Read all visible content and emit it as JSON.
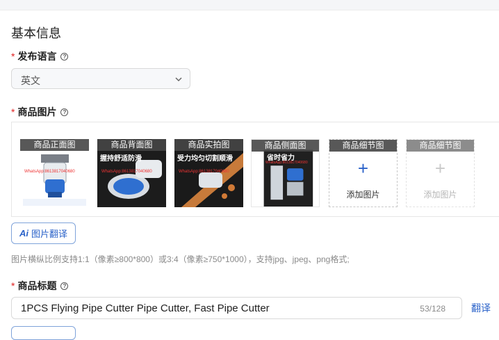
{
  "section": {
    "title": "基本信息"
  },
  "language": {
    "label": "发布语言",
    "required_mark": "*",
    "value": "英文"
  },
  "images": {
    "label": "商品图片",
    "required_mark": "*",
    "thumbnails": [
      {
        "label": "商品正面图",
        "watermark": "WhatsApp:8613817040680"
      },
      {
        "label": "商品背面图",
        "overlay": "握持舒适防滑",
        "watermark": "WhatsApp:8613817040680"
      },
      {
        "label": "商品实拍图",
        "overlay": "受力均匀切割顺滑",
        "watermark": "WhatsApp:8613817040680"
      },
      {
        "label": "商品侧面图",
        "overlay": "省时省力",
        "watermark": "WhatsApp:8613817040680"
      }
    ],
    "add_slots": [
      {
        "label": "商品细节图",
        "add_text": "添加图片",
        "state": "active"
      },
      {
        "label": "商品细节图",
        "add_text": "添加图片",
        "state": "disabled"
      }
    ],
    "ai_logo": "Ai",
    "ai_button": "图片翻译",
    "hint": "图片横纵比例支持1:1（像素≥800*800）或3:4（像素≥750*1000），支持jpg、jpeg、png格式;"
  },
  "product_title": {
    "label": "商品标题",
    "required_mark": "*",
    "value": "1PCS Flying Pipe Cutter Pipe Cutter, Fast Pipe Cutter",
    "counter": "53/128",
    "translate": "翻译"
  },
  "colors": {
    "accent": "#2a62c9",
    "required": "#e02020",
    "thumb_label_bg": "#464646"
  }
}
